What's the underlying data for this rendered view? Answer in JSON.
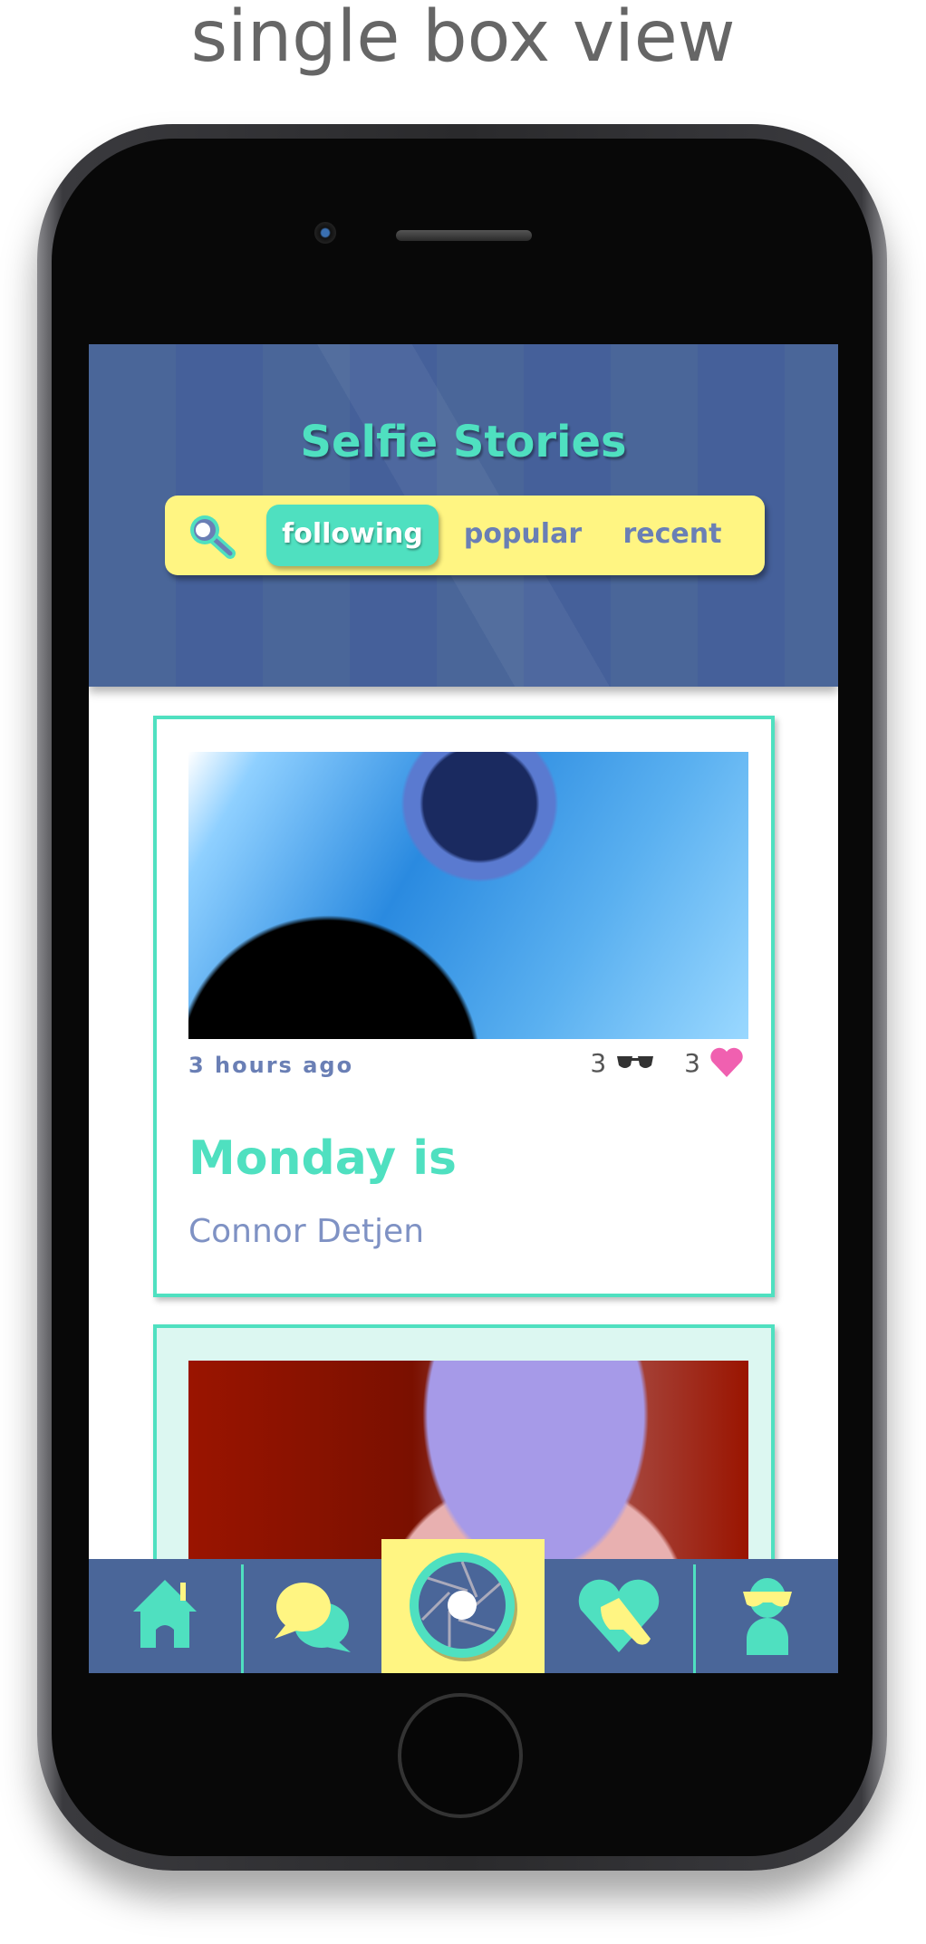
{
  "caption": "single box view",
  "app": {
    "title": "Selfie Stories",
    "tabs": [
      {
        "label": "following",
        "active": true
      },
      {
        "label": "popular",
        "active": false
      },
      {
        "label": "recent",
        "active": false
      }
    ]
  },
  "posts": [
    {
      "time": "3 hours ago",
      "sunglasses_count": "3",
      "likes_count": "3",
      "title": "Monday is",
      "author": "Connor Detjen"
    }
  ],
  "nav": {
    "items": [
      "home-icon",
      "chat-icon",
      "camera-shutter-icon",
      "heart-sunglasses-icon",
      "profile-icon"
    ],
    "active": "camera-shutter-icon"
  },
  "colors": {
    "header": "#4a6699",
    "accent_teal": "#4fe0c0",
    "accent_yellow": "#fff582",
    "text_blue": "#6a7fb5",
    "like_pink": "#f060b0"
  }
}
